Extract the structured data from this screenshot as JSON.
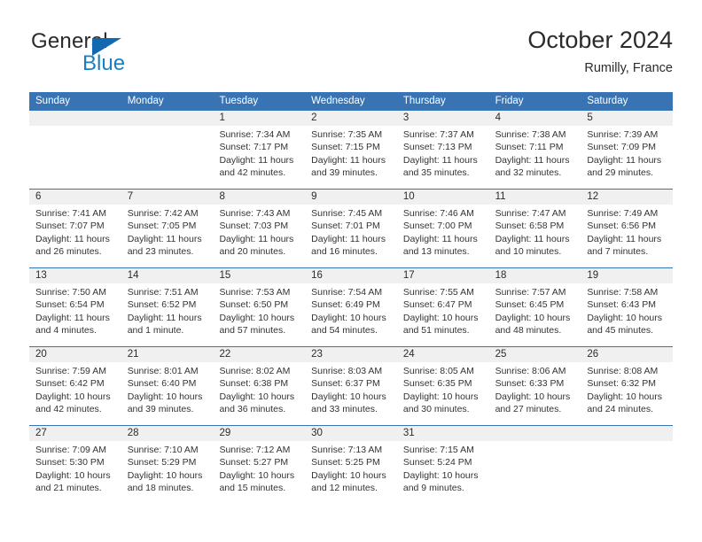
{
  "brand": {
    "word1": "General",
    "word2": "Blue",
    "triangle_color": "#1269b0",
    "blue_color": "#1a7fc1"
  },
  "header": {
    "title": "October 2024",
    "subtitle": "Rumilly, France"
  },
  "colors": {
    "header_row": "#3874b4",
    "daynum_band": "#f0f0f0",
    "text": "#333333"
  },
  "weekdays": [
    "Sunday",
    "Monday",
    "Tuesday",
    "Wednesday",
    "Thursday",
    "Friday",
    "Saturday"
  ],
  "weeks": [
    [
      {
        "day": "",
        "lines": []
      },
      {
        "day": "",
        "lines": []
      },
      {
        "day": "1",
        "lines": [
          "Sunrise: 7:34 AM",
          "Sunset: 7:17 PM",
          "Daylight: 11 hours",
          "and 42 minutes."
        ]
      },
      {
        "day": "2",
        "lines": [
          "Sunrise: 7:35 AM",
          "Sunset: 7:15 PM",
          "Daylight: 11 hours",
          "and 39 minutes."
        ]
      },
      {
        "day": "3",
        "lines": [
          "Sunrise: 7:37 AM",
          "Sunset: 7:13 PM",
          "Daylight: 11 hours",
          "and 35 minutes."
        ]
      },
      {
        "day": "4",
        "lines": [
          "Sunrise: 7:38 AM",
          "Sunset: 7:11 PM",
          "Daylight: 11 hours",
          "and 32 minutes."
        ]
      },
      {
        "day": "5",
        "lines": [
          "Sunrise: 7:39 AM",
          "Sunset: 7:09 PM",
          "Daylight: 11 hours",
          "and 29 minutes."
        ]
      }
    ],
    [
      {
        "day": "6",
        "lines": [
          "Sunrise: 7:41 AM",
          "Sunset: 7:07 PM",
          "Daylight: 11 hours",
          "and 26 minutes."
        ]
      },
      {
        "day": "7",
        "lines": [
          "Sunrise: 7:42 AM",
          "Sunset: 7:05 PM",
          "Daylight: 11 hours",
          "and 23 minutes."
        ]
      },
      {
        "day": "8",
        "lines": [
          "Sunrise: 7:43 AM",
          "Sunset: 7:03 PM",
          "Daylight: 11 hours",
          "and 20 minutes."
        ]
      },
      {
        "day": "9",
        "lines": [
          "Sunrise: 7:45 AM",
          "Sunset: 7:01 PM",
          "Daylight: 11 hours",
          "and 16 minutes."
        ]
      },
      {
        "day": "10",
        "lines": [
          "Sunrise: 7:46 AM",
          "Sunset: 7:00 PM",
          "Daylight: 11 hours",
          "and 13 minutes."
        ]
      },
      {
        "day": "11",
        "lines": [
          "Sunrise: 7:47 AM",
          "Sunset: 6:58 PM",
          "Daylight: 11 hours",
          "and 10 minutes."
        ]
      },
      {
        "day": "12",
        "lines": [
          "Sunrise: 7:49 AM",
          "Sunset: 6:56 PM",
          "Daylight: 11 hours",
          "and 7 minutes."
        ]
      }
    ],
    [
      {
        "day": "13",
        "lines": [
          "Sunrise: 7:50 AM",
          "Sunset: 6:54 PM",
          "Daylight: 11 hours",
          "and 4 minutes."
        ]
      },
      {
        "day": "14",
        "lines": [
          "Sunrise: 7:51 AM",
          "Sunset: 6:52 PM",
          "Daylight: 11 hours",
          "and 1 minute."
        ]
      },
      {
        "day": "15",
        "lines": [
          "Sunrise: 7:53 AM",
          "Sunset: 6:50 PM",
          "Daylight: 10 hours",
          "and 57 minutes."
        ]
      },
      {
        "day": "16",
        "lines": [
          "Sunrise: 7:54 AM",
          "Sunset: 6:49 PM",
          "Daylight: 10 hours",
          "and 54 minutes."
        ]
      },
      {
        "day": "17",
        "lines": [
          "Sunrise: 7:55 AM",
          "Sunset: 6:47 PM",
          "Daylight: 10 hours",
          "and 51 minutes."
        ]
      },
      {
        "day": "18",
        "lines": [
          "Sunrise: 7:57 AM",
          "Sunset: 6:45 PM",
          "Daylight: 10 hours",
          "and 48 minutes."
        ]
      },
      {
        "day": "19",
        "lines": [
          "Sunrise: 7:58 AM",
          "Sunset: 6:43 PM",
          "Daylight: 10 hours",
          "and 45 minutes."
        ]
      }
    ],
    [
      {
        "day": "20",
        "lines": [
          "Sunrise: 7:59 AM",
          "Sunset: 6:42 PM",
          "Daylight: 10 hours",
          "and 42 minutes."
        ]
      },
      {
        "day": "21",
        "lines": [
          "Sunrise: 8:01 AM",
          "Sunset: 6:40 PM",
          "Daylight: 10 hours",
          "and 39 minutes."
        ]
      },
      {
        "day": "22",
        "lines": [
          "Sunrise: 8:02 AM",
          "Sunset: 6:38 PM",
          "Daylight: 10 hours",
          "and 36 minutes."
        ]
      },
      {
        "day": "23",
        "lines": [
          "Sunrise: 8:03 AM",
          "Sunset: 6:37 PM",
          "Daylight: 10 hours",
          "and 33 minutes."
        ]
      },
      {
        "day": "24",
        "lines": [
          "Sunrise: 8:05 AM",
          "Sunset: 6:35 PM",
          "Daylight: 10 hours",
          "and 30 minutes."
        ]
      },
      {
        "day": "25",
        "lines": [
          "Sunrise: 8:06 AM",
          "Sunset: 6:33 PM",
          "Daylight: 10 hours",
          "and 27 minutes."
        ]
      },
      {
        "day": "26",
        "lines": [
          "Sunrise: 8:08 AM",
          "Sunset: 6:32 PM",
          "Daylight: 10 hours",
          "and 24 minutes."
        ]
      }
    ],
    [
      {
        "day": "27",
        "lines": [
          "Sunrise: 7:09 AM",
          "Sunset: 5:30 PM",
          "Daylight: 10 hours",
          "and 21 minutes."
        ]
      },
      {
        "day": "28",
        "lines": [
          "Sunrise: 7:10 AM",
          "Sunset: 5:29 PM",
          "Daylight: 10 hours",
          "and 18 minutes."
        ]
      },
      {
        "day": "29",
        "lines": [
          "Sunrise: 7:12 AM",
          "Sunset: 5:27 PM",
          "Daylight: 10 hours",
          "and 15 minutes."
        ]
      },
      {
        "day": "30",
        "lines": [
          "Sunrise: 7:13 AM",
          "Sunset: 5:25 PM",
          "Daylight: 10 hours",
          "and 12 minutes."
        ]
      },
      {
        "day": "31",
        "lines": [
          "Sunrise: 7:15 AM",
          "Sunset: 5:24 PM",
          "Daylight: 10 hours",
          "and 9 minutes."
        ]
      },
      {
        "day": "",
        "lines": []
      },
      {
        "day": "",
        "lines": []
      }
    ]
  ]
}
